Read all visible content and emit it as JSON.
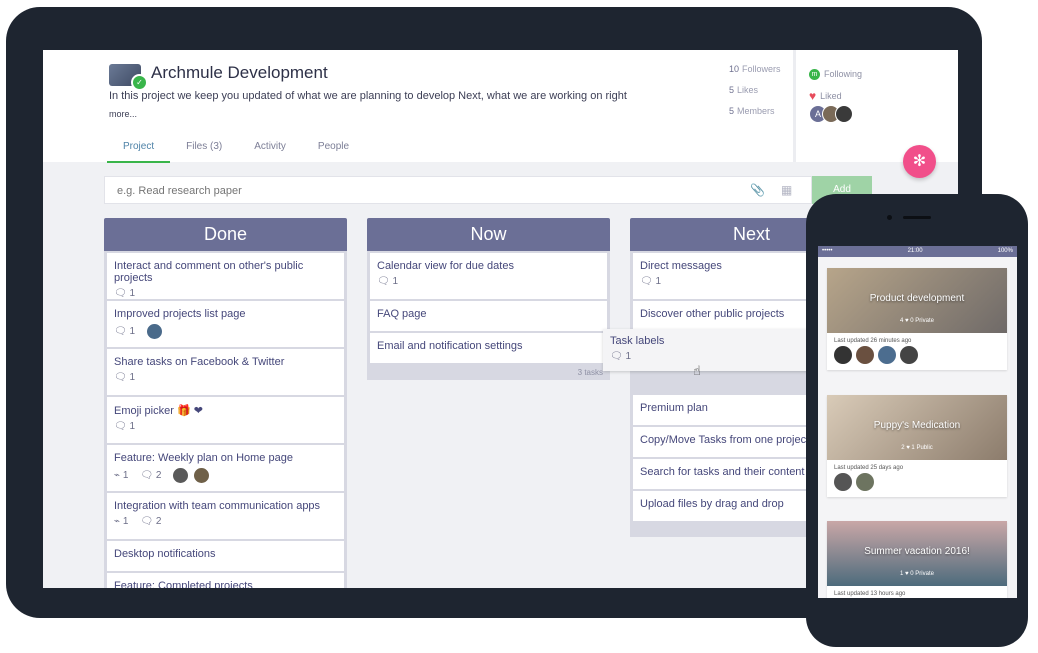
{
  "project": {
    "title": "Archmule Development",
    "description": "In this project we keep you updated of what we are planning to develop Next, what we are working on right",
    "more": "more...",
    "stats": [
      {
        "count": "10",
        "label": "Followers"
      },
      {
        "count": "5",
        "label": "Likes"
      },
      {
        "count": "5",
        "label": "Members"
      }
    ],
    "following": "Following",
    "liked": "Liked",
    "avatar_letter": "A"
  },
  "tabs": [
    "Project",
    "Files (3)",
    "Activity",
    "People"
  ],
  "task_input": {
    "placeholder": "e.g. Read research paper",
    "add_label": "Add"
  },
  "columns": {
    "done": {
      "title": "Done",
      "cards": [
        {
          "title": "Interact and comment on other's public projects",
          "comments": "1"
        },
        {
          "title": "Improved projects list page",
          "comments": "1"
        },
        {
          "title": "Share tasks on Facebook & Twitter",
          "comments": "1"
        },
        {
          "title": "Emoji picker 🎁 ❤",
          "comments": "1"
        },
        {
          "title": "Feature: Weekly plan on Home page",
          "attachments": "1",
          "comments": "2"
        },
        {
          "title": "Integration with team communication apps",
          "attachments": "1",
          "comments": "2"
        },
        {
          "title": "Desktop notifications"
        },
        {
          "title": "Feature: Completed projects"
        }
      ]
    },
    "now": {
      "title": "Now",
      "cards": [
        {
          "title": "Calendar view for due dates",
          "comments": "1"
        },
        {
          "title": "FAQ page"
        },
        {
          "title": "Email and notification settings"
        }
      ],
      "footer": "3 tasks"
    },
    "next": {
      "title": "Next",
      "cards": [
        {
          "title": "Direct messages",
          "comments": "1"
        },
        {
          "title": "Discover other public projects"
        },
        {
          "title": "Premium plan"
        },
        {
          "title": "Copy/Move Tasks from one project to"
        },
        {
          "title": "Search for tasks and their content"
        },
        {
          "title": "Upload files by drag and drop"
        }
      ]
    }
  },
  "dragging_card": {
    "title": "Task labels",
    "comments": "1"
  },
  "phone": {
    "time": "21:00",
    "battery": "100%",
    "cards": [
      {
        "title": "Product development",
        "meta": "4  ♥ 0  Private",
        "updated": "Last updated 26 minutes ago"
      },
      {
        "title": "Puppy's Medication",
        "meta": "2  ♥ 1  Public",
        "updated": "Last updated 25 days ago"
      },
      {
        "title": "Summer vacation 2016!",
        "meta": "1  ♥ 0  Private",
        "updated": "Last updated 13 hours ago"
      }
    ]
  },
  "colors": {
    "header_bar": "#6b6f96",
    "accent_green": "#39b54a",
    "fab_pink": "#f14f8a",
    "heart_red": "#e74c5c"
  },
  "icons": [
    "share-network-icon",
    "paperclip-icon",
    "calendar-icon",
    "comment-icon",
    "hand-cursor-icon",
    "heart-icon",
    "follow-icon"
  ]
}
